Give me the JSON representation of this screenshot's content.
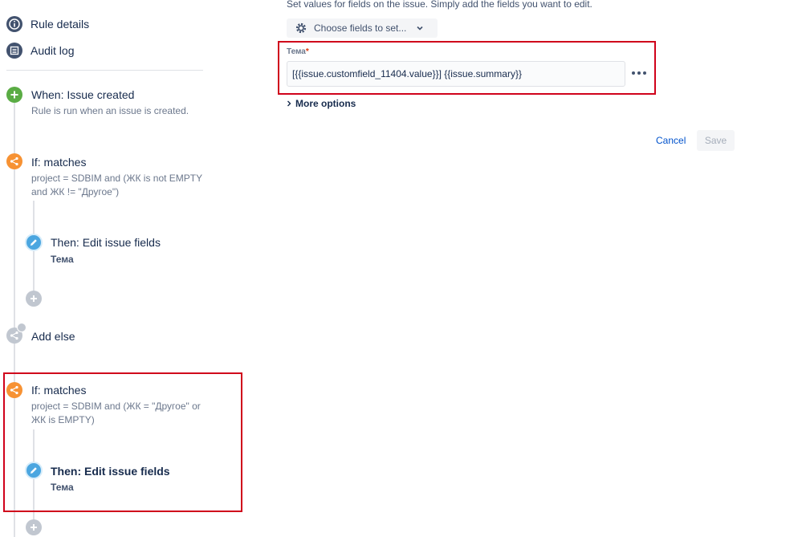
{
  "sidebar": {
    "nav": [
      {
        "label": "Rule details",
        "icon": "info-icon"
      },
      {
        "label": "Audit log",
        "icon": "list-icon"
      }
    ],
    "steps": {
      "trigger": {
        "title": "When: Issue created",
        "desc": "Rule is run when an issue is created."
      },
      "cond1": {
        "title": "If: matches",
        "desc_line1": "project = SDBIM and (ЖК is not EMPTY",
        "desc_line2": "and ЖК != \"Другое\")"
      },
      "action1": {
        "title": "Then: Edit issue fields",
        "sub": "Тема"
      },
      "add_else": {
        "title": "Add else"
      },
      "cond2": {
        "title": "If: matches",
        "desc_line1": "project = SDBIM and (ЖК = \"Другое\" or",
        "desc_line2": "ЖК is EMPTY)"
      },
      "action2": {
        "title": "Then: Edit issue fields",
        "sub": "Тема"
      }
    }
  },
  "main": {
    "intro": "Set values for fields on the issue. Simply add the fields you want to edit.",
    "choose_fields_label": "Choose fields to set...",
    "field_label": "Тема",
    "field_required_mark": "*",
    "field_value": "[{{issue.customfield_11404.value}}] {{issue.summary}}",
    "more_options": "More options",
    "cancel_label": "Cancel",
    "save_label": "Save"
  },
  "colors": {
    "highlight": "#d0021b",
    "link": "#0052cc"
  }
}
